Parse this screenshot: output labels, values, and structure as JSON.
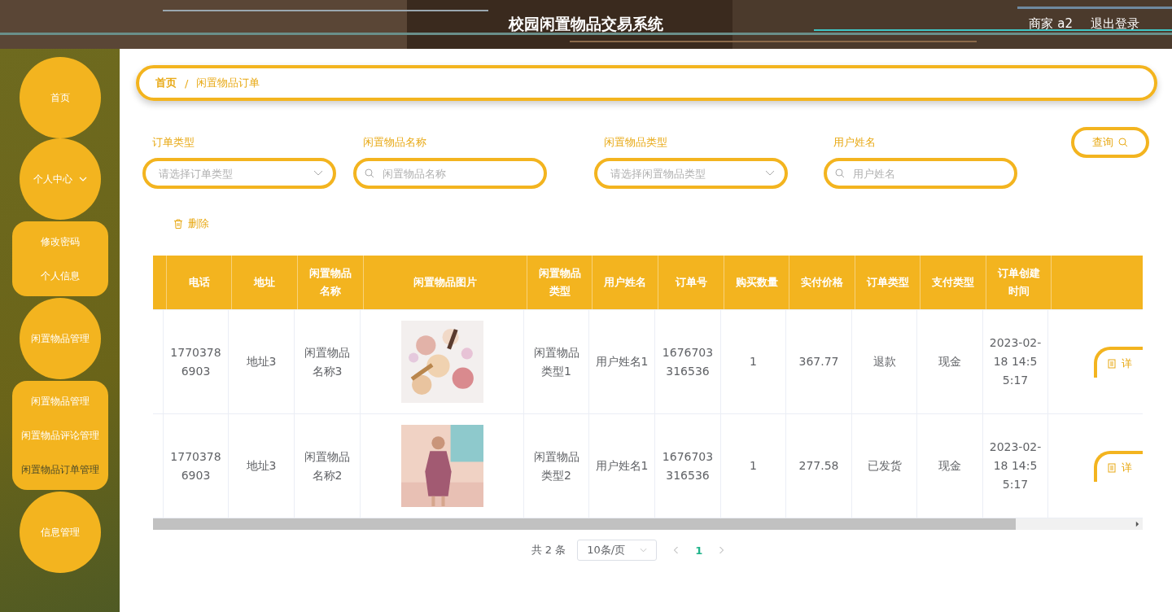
{
  "header": {
    "title": "校园闲置物品交易系统",
    "user": "商家 a2",
    "logout": "退出登录"
  },
  "sidebar": {
    "menus": [
      {
        "label": "首页"
      },
      {
        "label": "个人中心",
        "expanded": true,
        "children": [
          {
            "label": "修改密码",
            "selected": false
          },
          {
            "label": "个人信息",
            "selected": false
          }
        ]
      },
      {
        "label": "闲置物品管理",
        "expanded": true,
        "children": [
          {
            "label": "闲置物品管理",
            "selected": false
          },
          {
            "label": "闲置物品评论管理",
            "selected": false
          },
          {
            "label": "闲置物品订单管理",
            "selected": true
          }
        ]
      },
      {
        "label": "信息管理"
      }
    ]
  },
  "breadcrumb": [
    {
      "label": "首页"
    },
    {
      "label": "闲置物品订单"
    }
  ],
  "breadcrumb_separator": "/",
  "filters": [
    {
      "kind": "select",
      "label": "订单类型",
      "placeholder": "请选择订单类型"
    },
    {
      "kind": "search",
      "label": "闲置物品名称",
      "placeholder": "闲置物品名称"
    },
    {
      "kind": "select",
      "label": "闲置物品类型",
      "placeholder": "请选择闲置物品类型"
    },
    {
      "kind": "search",
      "label": "用户姓名",
      "placeholder": "用户姓名"
    }
  ],
  "query_button": "查询",
  "delete_button": "删除",
  "table": {
    "columns": [
      "电话",
      "地址",
      "闲置物品名称",
      "闲置物品图片",
      "闲置物品类型",
      "用户姓名",
      "订单号",
      "购买数量",
      "实付价格",
      "订单类型",
      "支付类型",
      "订单创建时间"
    ],
    "rows": [
      {
        "cells": [
          "17703786903",
          "地址3",
          "闲置物品名称3",
          {
            "kind": "picture"
          },
          "闲置物品类型1",
          "用户姓名1",
          "1676703316536",
          "1",
          "367.77",
          "退款",
          "现金",
          "2023-02-18 14:55:17"
        ],
        "action": "详"
      },
      {
        "cells": [
          "17703786903",
          "地址3",
          "闲置物品名称2",
          {
            "kind": "picture"
          },
          "闲置物品类型2",
          "用户姓名1",
          "1676703316536",
          "1",
          "277.58",
          "已发货",
          "现金",
          "2023-02-18 14:55:17"
        ],
        "action": "详"
      }
    ]
  },
  "pagination": {
    "total": "共 2 条",
    "page_size": "10条/页",
    "pages": [
      {
        "label": "1",
        "selected": true
      }
    ]
  }
}
